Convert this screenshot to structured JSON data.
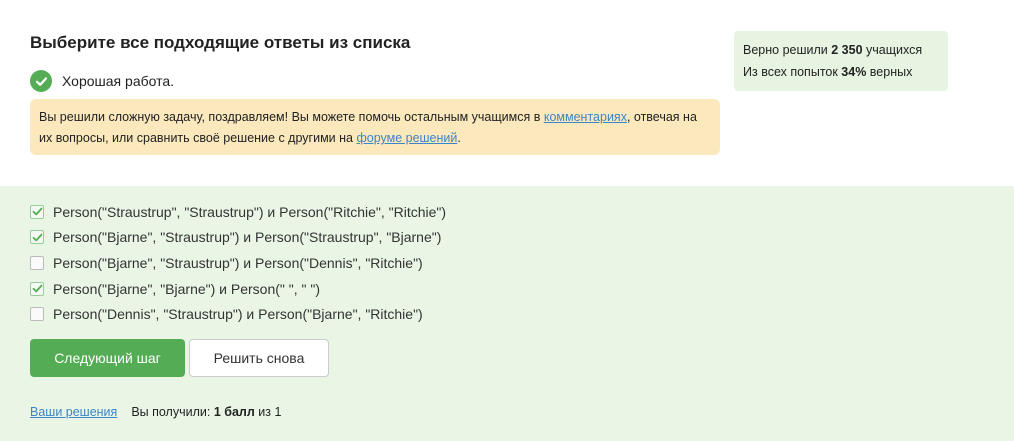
{
  "header": {
    "title": "Выберите все подходящие ответы из списка"
  },
  "result": {
    "message": "Хорошая работа."
  },
  "notice": {
    "text_before": "Вы решили сложную задачу, поздравляем! Вы можете помочь остальным учащимся в ",
    "link1": "комментариях",
    "text_middle": ", отвечая на их вопросы, или сравнить своё решение с другими на ",
    "link2": "форуме решений",
    "text_after": "."
  },
  "stats": {
    "line1_prefix": "Верно решили ",
    "solved_count": "2 350",
    "line1_suffix": " учащихся",
    "line2_prefix": "Из всех попыток ",
    "percent": "34%",
    "line2_suffix": " верных"
  },
  "options": [
    {
      "label": "Person(\"Straustrup\", \"Straustrup\") и Person(\"Ritchie\", \"Ritchie\")",
      "checked": true
    },
    {
      "label": "Person(\"Bjarne\", \"Straustrup\") и Person(\"Straustrup\", \"Bjarne\")",
      "checked": true
    },
    {
      "label": "Person(\"Bjarne\", \"Straustrup\") и Person(\"Dennis\", \"Ritchie\")",
      "checked": false
    },
    {
      "label": "Person(\"Bjarne\", \"Bjarne\") и Person(\" \", \" \")",
      "checked": true
    },
    {
      "label": "Person(\"Dennis\", \"Straustrup\") и Person(\"Bjarne\", \"Ritchie\")",
      "checked": false
    }
  ],
  "buttons": {
    "next": "Следующий шаг",
    "retry": "Решить снова"
  },
  "footer": {
    "solutions_link": "Ваши решения",
    "score_prefix": "Вы получили: ",
    "score_value": "1 балл",
    "score_suffix": " из 1"
  }
}
